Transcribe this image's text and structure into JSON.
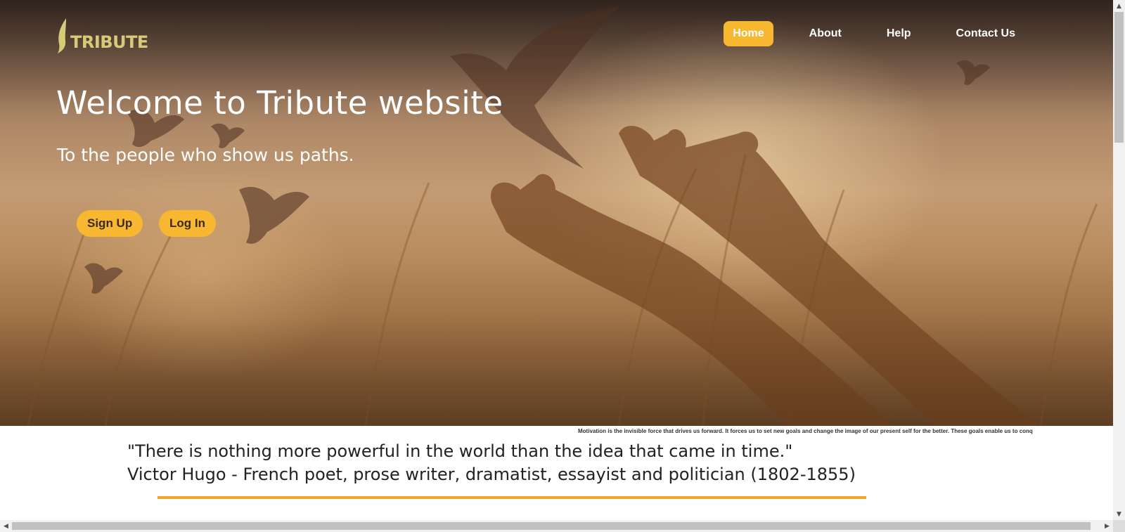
{
  "brand": {
    "name": "TRIBUTE",
    "logo_color": "#d6c978"
  },
  "nav": {
    "items": [
      {
        "label": "Home",
        "active": true
      },
      {
        "label": "About",
        "active": false
      },
      {
        "label": "Help",
        "active": false
      },
      {
        "label": "Contact Us",
        "active": false
      }
    ]
  },
  "hero": {
    "title": "Welcome to Tribute website",
    "subtitle": "To the people who show us paths.",
    "signup_label": "Sign Up",
    "login_label": "Log In"
  },
  "marquee": {
    "text": "Motivation is the invisible force that drives us forward. It forces us to set new goals and change the image of our present self for the better. These goals enable us to conq"
  },
  "quote": {
    "text": "\"There is nothing more powerful in the world than the idea that came in time.\"",
    "author": "Victor Hugo - French poet, prose writer, dramatist, essayist and politician (1802-1855)"
  },
  "colors": {
    "accent": "#f7b731",
    "rule": "#f6a22c",
    "nav_text": "#ffffff"
  }
}
